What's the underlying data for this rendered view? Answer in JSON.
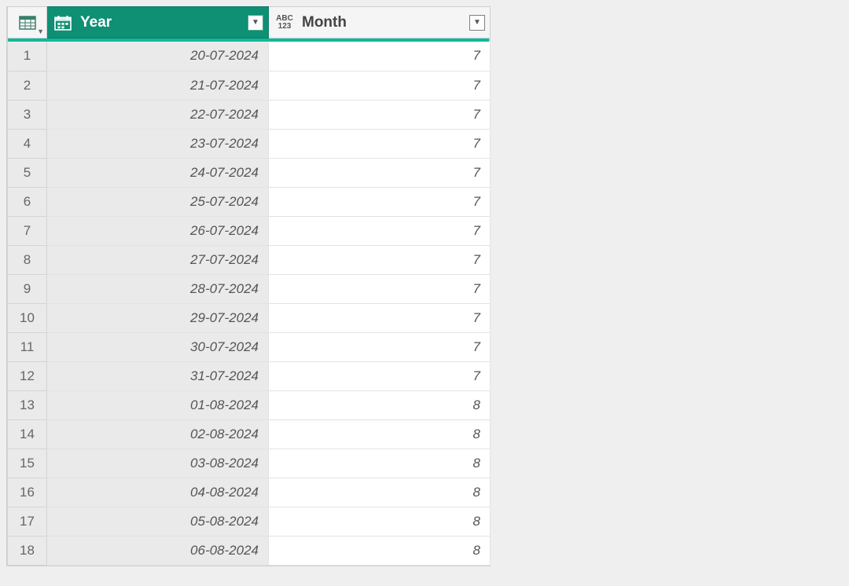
{
  "columns": {
    "year": {
      "label": "Year",
      "type_icon": "date",
      "selected": true
    },
    "month": {
      "label": "Month",
      "type_icon": "any",
      "selected": false
    }
  },
  "rows": [
    {
      "n": 1,
      "year": "20-07-2024",
      "month": "7"
    },
    {
      "n": 2,
      "year": "21-07-2024",
      "month": "7"
    },
    {
      "n": 3,
      "year": "22-07-2024",
      "month": "7"
    },
    {
      "n": 4,
      "year": "23-07-2024",
      "month": "7"
    },
    {
      "n": 5,
      "year": "24-07-2024",
      "month": "7"
    },
    {
      "n": 6,
      "year": "25-07-2024",
      "month": "7"
    },
    {
      "n": 7,
      "year": "26-07-2024",
      "month": "7"
    },
    {
      "n": 8,
      "year": "27-07-2024",
      "month": "7"
    },
    {
      "n": 9,
      "year": "28-07-2024",
      "month": "7"
    },
    {
      "n": 10,
      "year": "29-07-2024",
      "month": "7"
    },
    {
      "n": 11,
      "year": "30-07-2024",
      "month": "7"
    },
    {
      "n": 12,
      "year": "31-07-2024",
      "month": "7"
    },
    {
      "n": 13,
      "year": "01-08-2024",
      "month": "8"
    },
    {
      "n": 14,
      "year": "02-08-2024",
      "month": "8"
    },
    {
      "n": 15,
      "year": "03-08-2024",
      "month": "8"
    },
    {
      "n": 16,
      "year": "04-08-2024",
      "month": "8"
    },
    {
      "n": 17,
      "year": "05-08-2024",
      "month": "8"
    },
    {
      "n": 18,
      "year": "06-08-2024",
      "month": "8"
    }
  ]
}
